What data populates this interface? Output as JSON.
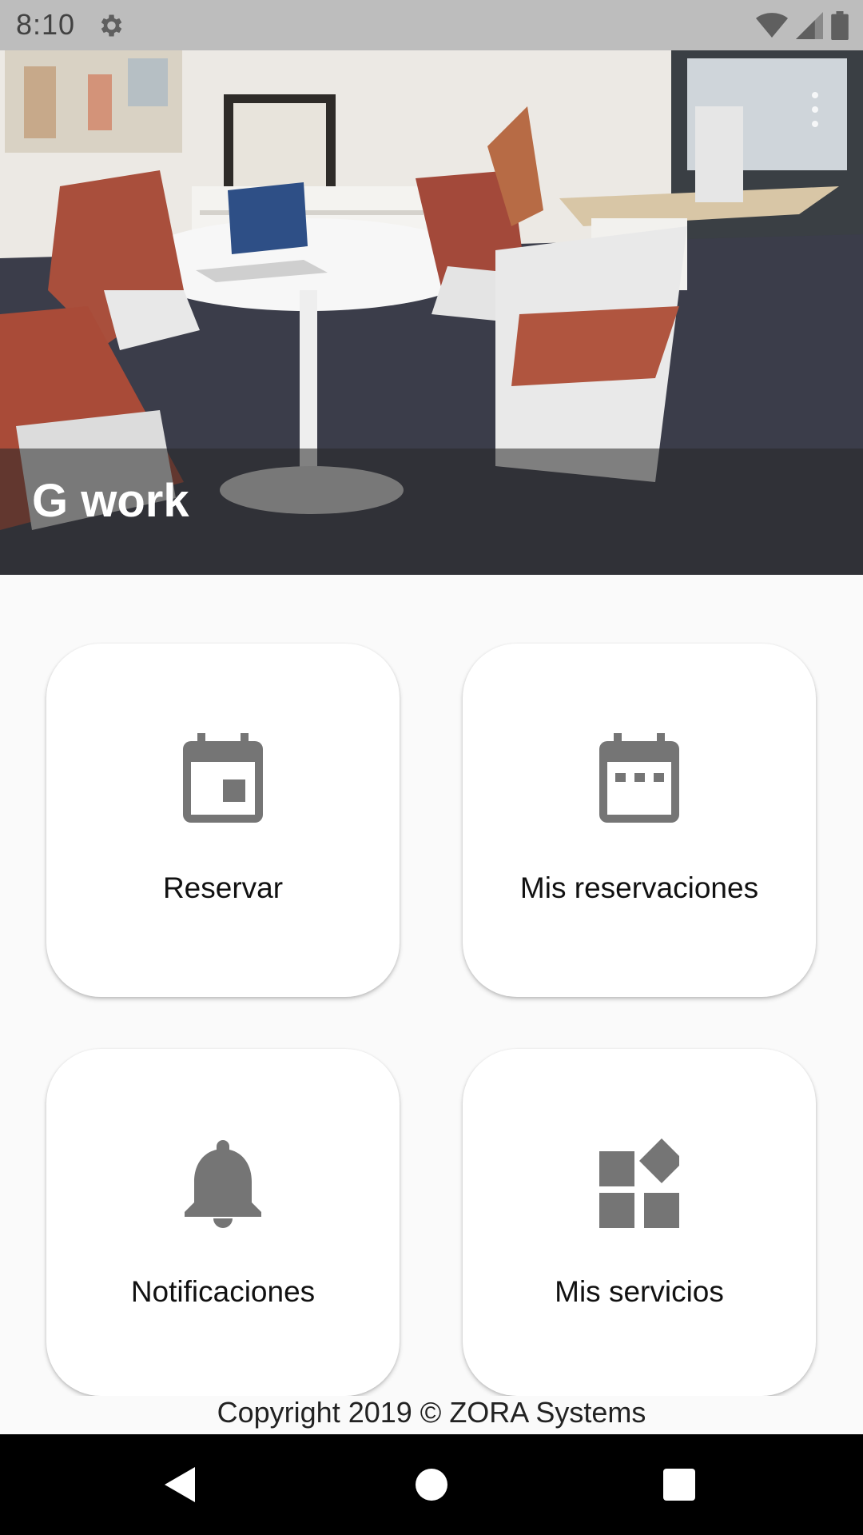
{
  "status_bar": {
    "time": "8:10",
    "icons": [
      "gear-icon",
      "wifi-icon",
      "signal-icon",
      "battery-icon"
    ]
  },
  "header": {
    "title": "G work",
    "image": "office-interior-photo"
  },
  "menu": {
    "tiles": [
      {
        "label": "Reservar",
        "icon": "calendar-event-icon"
      },
      {
        "label": "Mis reservaciones",
        "icon": "calendar-dots-icon"
      },
      {
        "label": "Notificaciones",
        "icon": "bell-icon"
      },
      {
        "label": "Mis servicios",
        "icon": "widgets-icon"
      }
    ]
  },
  "footer": {
    "copyright": "Copyright 2019 © ZORA Systems"
  },
  "navigation": {
    "buttons": [
      "back-icon",
      "home-icon",
      "recents-icon"
    ]
  },
  "colors": {
    "status_bar": "#bdbdbd",
    "icon_gray": "#757575",
    "tile_bg": "#ffffff",
    "page_bg": "#fafafa",
    "nav_bar": "#000000"
  }
}
